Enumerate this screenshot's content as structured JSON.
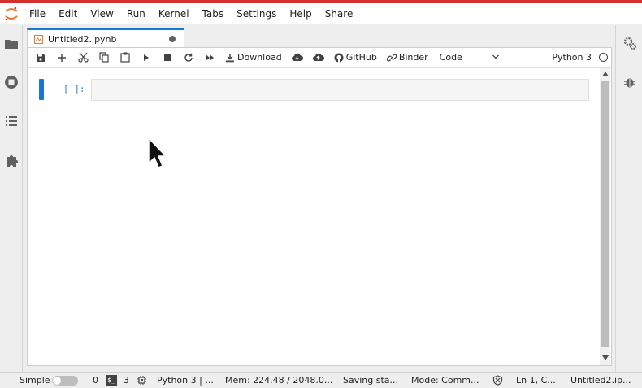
{
  "menu": [
    "File",
    "Edit",
    "View",
    "Run",
    "Kernel",
    "Tabs",
    "Settings",
    "Help",
    "Share"
  ],
  "tab": {
    "label": "Untitled2.ipynb"
  },
  "toolbar": {
    "download": "Download",
    "github": "GitHub",
    "binder": "Binder",
    "cell_type": "Code",
    "kernel": "Python 3"
  },
  "cell": {
    "prompt": "[ ]:"
  },
  "status": {
    "mode_label": "Simple",
    "count_a": "0",
    "terminal_icon_text": "$_",
    "count_b": "3",
    "kernel": "Python 3 | ...",
    "mem": "Mem: 224.48 / 2048.0...",
    "saving": "Saving sta...",
    "mode": "Mode: Comm...",
    "position": "Ln 1, C...",
    "filename": "Untitled2.ip..."
  },
  "colors": {
    "accent": "#1976d2",
    "brand": "#d32f2f",
    "logo": "#f37726"
  }
}
